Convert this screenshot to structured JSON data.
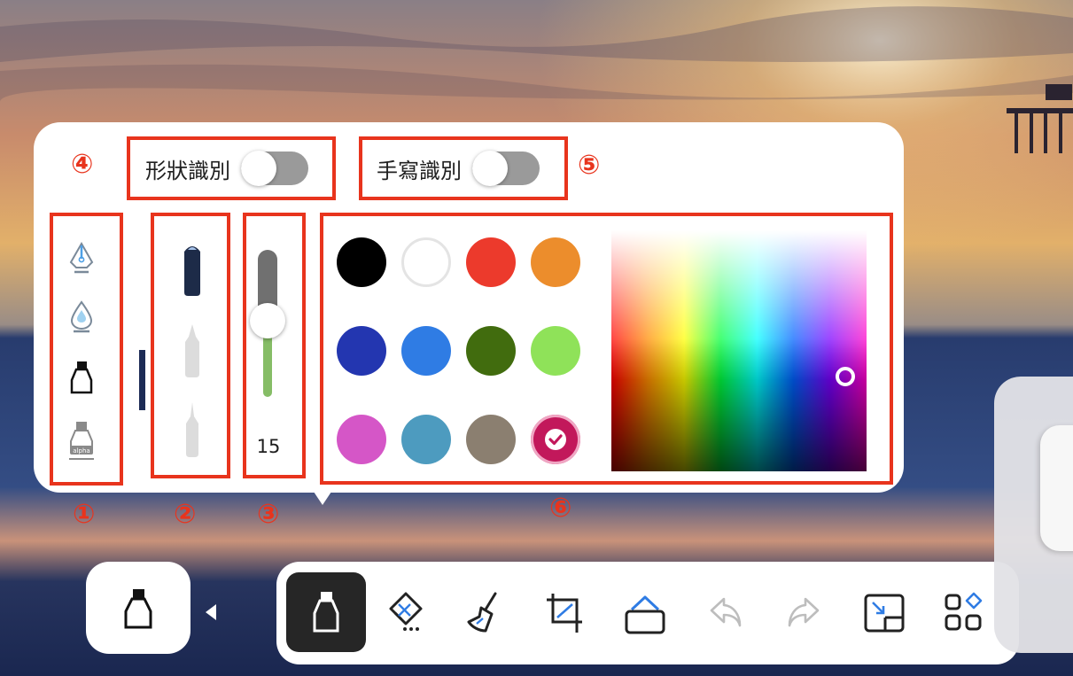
{
  "panel": {
    "shape_recognition": {
      "label": "形狀識別",
      "enabled": false
    },
    "handwriting_recognition": {
      "label": "手寫識別",
      "enabled": false
    },
    "pen_types": [
      {
        "name": "fountain-pen",
        "selected": false
      },
      {
        "name": "ink-pen",
        "selected": false
      },
      {
        "name": "marker",
        "selected": true
      },
      {
        "name": "highlighter",
        "selected": false,
        "label": "alpha"
      }
    ],
    "tips": [
      {
        "name": "flat-tip",
        "selected": true
      },
      {
        "name": "round-tip",
        "selected": false
      },
      {
        "name": "fine-tip",
        "selected": false
      }
    ],
    "thickness": {
      "value": "15"
    },
    "colors": {
      "swatches": [
        "#000000",
        "#ffffff",
        "#ec3a2c",
        "#ec8d2c",
        "#2336b0",
        "#2f7ce4",
        "#416c0e",
        "#8fe259",
        "#d556c7",
        "#4d9bbf",
        "#8b7f70",
        "#c2185b"
      ],
      "selected_index": 11
    }
  },
  "markers": {
    "m1": "①",
    "m2": "②",
    "m3": "③",
    "m4": "④",
    "m5": "⑤",
    "m6": "⑥"
  },
  "toolbar": {
    "tools": [
      {
        "name": "pen-tool",
        "active": true
      },
      {
        "name": "eraser-tool",
        "active": false
      },
      {
        "name": "clear-brush-tool",
        "active": false
      },
      {
        "name": "crop-tool",
        "active": false
      },
      {
        "name": "shape-tool",
        "active": false
      },
      {
        "name": "undo",
        "active": false,
        "disabled": true
      },
      {
        "name": "redo",
        "active": false,
        "disabled": true
      },
      {
        "name": "minimize",
        "active": false
      },
      {
        "name": "more-apps",
        "active": false
      }
    ]
  },
  "colors": {
    "accent": "#2f7ce4",
    "annotation": "#e8341d",
    "toolbar_active": "#262626"
  }
}
